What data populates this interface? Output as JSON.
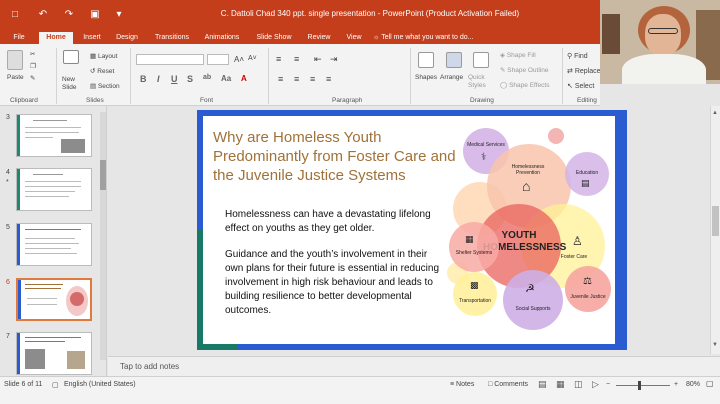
{
  "window": {
    "title": "C. Dattoli Chad 340 ppt. single presentation - PowerPoint (Product Activation Failed)"
  },
  "tabs": [
    "File",
    "Home",
    "Insert",
    "Design",
    "Transitions",
    "Animations",
    "Slide Show",
    "Review",
    "View"
  ],
  "active_tab": "Home",
  "tell_me": "Tell me what you want to do...",
  "ribbon": {
    "clipboard": {
      "paste": "Paste",
      "label": "Clipboard"
    },
    "slides": {
      "new_slide": "New Slide",
      "layout": "Layout",
      "reset": "Reset",
      "section": "Section",
      "label": "Slides"
    },
    "font": {
      "label": "Font"
    },
    "paragraph": {
      "label": "Paragraph"
    },
    "drawing": {
      "shapes": "Shapes",
      "arrange": "Arrange",
      "quick_styles": "Quick Styles",
      "shape_fill": "Shape Fill",
      "shape_outline": "Shape Outline",
      "shape_effects": "Shape Effects",
      "label": "Drawing"
    },
    "editing": {
      "find": "Find",
      "replace": "Replace",
      "select": "Select",
      "label": "Editing"
    }
  },
  "thumbnails": [
    {
      "num": "3",
      "star": ""
    },
    {
      "num": "4",
      "star": "*"
    },
    {
      "num": "5",
      "star": ""
    },
    {
      "num": "6",
      "star": ""
    },
    {
      "num": "7",
      "star": ""
    }
  ],
  "slide": {
    "title": "Why are Homeless Youth Predominantly from Foster Care and the Juvenile Justice Systems",
    "paragraph1": "Homelessness can have a devastating lifelong effect on youths as they get older.",
    "paragraph2": "Guidance and the youth’s involvement in their own plans for their future is essential in reducing involvement in high risk behaviour and leads to building resilience to better developmental outcomes.",
    "diagram": {
      "center": "YOUTH HOMELESSNESS",
      "nodes": [
        "Medical Services",
        "Homelessness Prevention",
        "Education",
        "Shelter Systems",
        "Foster Care",
        "Transportation",
        "Social Supports",
        "Juvenile Justice"
      ]
    }
  },
  "notes_placeholder": "Tap to add notes",
  "status": {
    "slide_info": "Slide 6 of 11",
    "language": "English (United States)",
    "notes": "Notes",
    "comments": "Comments",
    "zoom": "80%"
  },
  "colors": {
    "accent": "#c43e1c",
    "slide_title": "#a0723a",
    "selected_thumb": "#e07a3c"
  }
}
